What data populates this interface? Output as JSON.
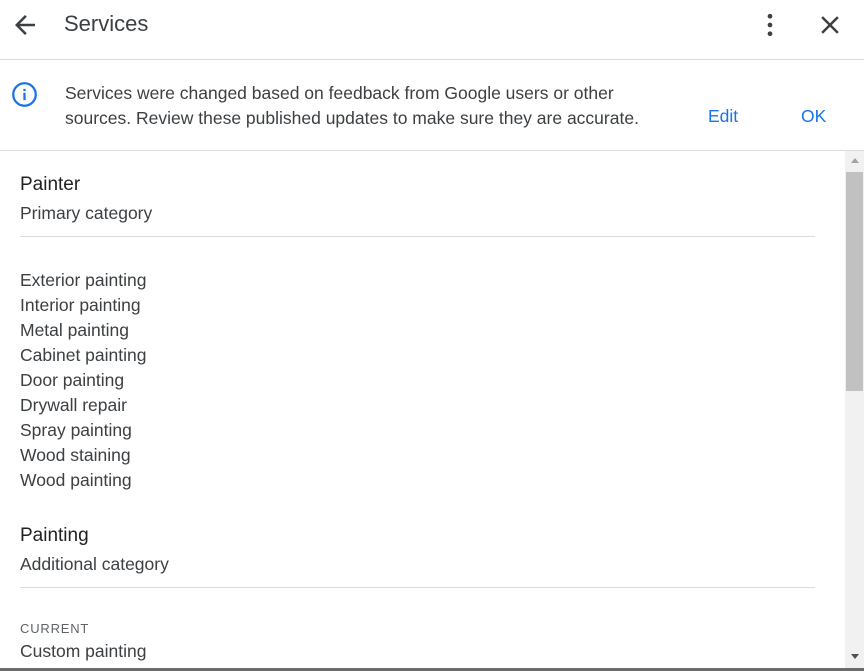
{
  "header": {
    "title": "Services"
  },
  "banner": {
    "message": "Services were changed based on feedback from Google users or other sources. Review these published updates to make sure they are accurate.",
    "edit_label": "Edit",
    "ok_label": "OK"
  },
  "categories": [
    {
      "name": "Painter",
      "type": "Primary category",
      "services": [
        "Exterior painting",
        "Interior painting",
        "Metal painting",
        "Cabinet painting",
        "Door painting",
        "Drywall repair",
        "Spray painting",
        "Wood staining",
        "Wood painting"
      ]
    },
    {
      "name": "Painting",
      "type": "Additional category",
      "section_label": "CURRENT",
      "services": [
        "Custom painting"
      ]
    }
  ],
  "icons": {
    "back": "arrow-back-icon",
    "more": "more-vert-icon",
    "close": "close-icon",
    "info": "info-icon"
  },
  "colors": {
    "accent": "#1a73e8",
    "text": "#202124",
    "secondary_text": "#3c4043",
    "divider": "#dadce0"
  }
}
